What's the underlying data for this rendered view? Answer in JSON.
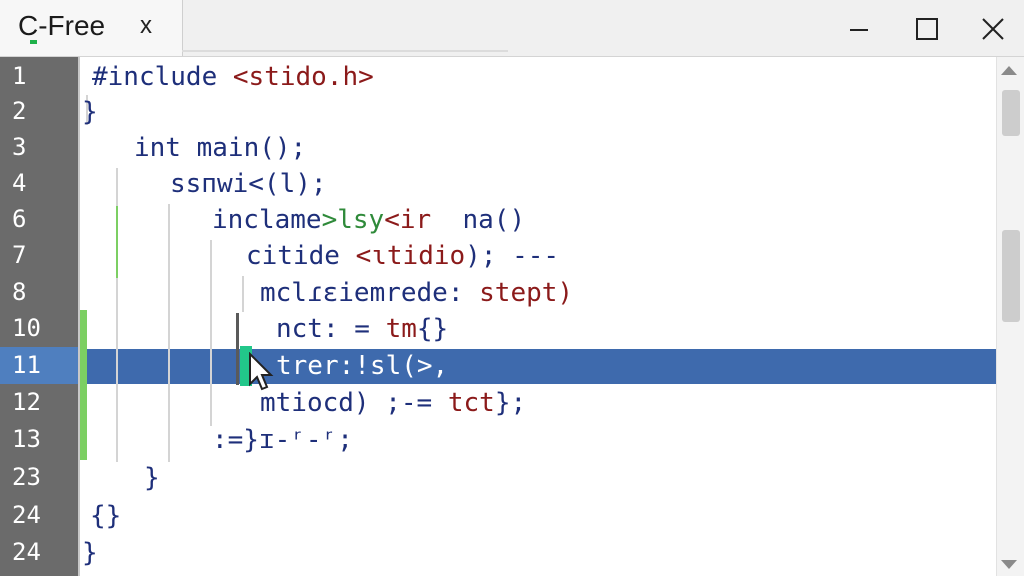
{
  "window": {
    "tab_title": "C-Free",
    "tab_close_glyph": "x",
    "controls": [
      "minimize-icon",
      "maximize-icon",
      "close-icon"
    ]
  },
  "editor": {
    "line_numbers": [
      "1",
      "2",
      "3",
      "4",
      "6",
      "7",
      "8",
      "10",
      "11",
      "12",
      "13",
      "23",
      "24",
      "24"
    ],
    "active_line": "11",
    "lines": [
      {
        "segments": [
          {
            "t": "#include ",
            "c": "kw"
          },
          {
            "t": "<stido.h>",
            "c": "str"
          }
        ]
      },
      {
        "segments": [
          {
            "t": "}",
            "c": "kw"
          }
        ]
      },
      {
        "segments": [
          {
            "t": "int main();",
            "c": "kw"
          }
        ]
      },
      {
        "segments": [
          {
            "t": "ssпwi<(l);",
            "c": "kw"
          }
        ]
      },
      {
        "segments": [
          {
            "t": "inclame",
            "c": "kw"
          },
          {
            "t": ">lsy",
            "c": "grn"
          },
          {
            "t": "<ir  ",
            "c": "str"
          },
          {
            "t": "na()",
            "c": "kw"
          }
        ]
      },
      {
        "segments": [
          {
            "t": "citide ",
            "c": "kw"
          },
          {
            "t": "<ɩtidio",
            "c": "str"
          },
          {
            "t": "); ---",
            "c": "kw"
          }
        ]
      },
      {
        "segments": [
          {
            "t": "mclɾɛiemrede: ",
            "c": "kw"
          },
          {
            "t": "stept)",
            "c": "str"
          }
        ]
      },
      {
        "segments": [
          {
            "t": "nct: = ",
            "c": "kw"
          },
          {
            "t": "tm",
            "c": "str"
          },
          {
            "t": "{}",
            "c": "kw"
          }
        ]
      },
      {
        "segments": [
          {
            "t": "trer:!sl(>,",
            "c": "sel"
          }
        ]
      },
      {
        "segments": [
          {
            "t": "mtiocd) ;-= ",
            "c": "kw"
          },
          {
            "t": "tct",
            "c": "str"
          },
          {
            "t": "};",
            "c": "kw"
          }
        ]
      },
      {
        "segments": [
          {
            "t": ":=}ɪ-ʳ-ʳ;",
            "c": "kw"
          }
        ]
      },
      {
        "segments": [
          {
            "t": "}",
            "c": "kw"
          }
        ]
      },
      {
        "segments": [
          {
            "t": "{}",
            "c": "kw"
          }
        ]
      },
      {
        "segments": [
          {
            "t": "}",
            "c": "kw"
          }
        ]
      }
    ]
  },
  "colors": {
    "gutter": "#6b6b6b",
    "selection": "#3e6aad",
    "keyword": "#1e2f7a",
    "string": "#8b1a1a",
    "caret": "#22c78a"
  }
}
